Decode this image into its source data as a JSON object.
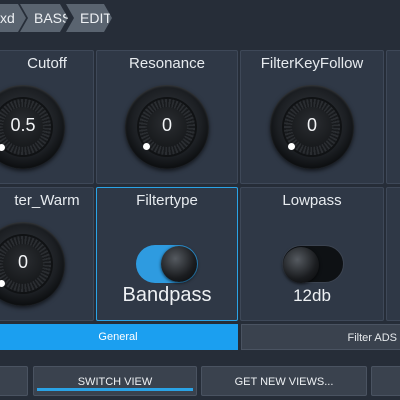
{
  "breadcrumb": [
    "xd",
    "BASS",
    "EDIT"
  ],
  "knobs_row1": [
    {
      "label": "Cutoff",
      "value": "0.5"
    },
    {
      "label": "Resonance",
      "value": "0"
    },
    {
      "label": "FilterKeyFollow",
      "value": "0"
    }
  ],
  "knobs_row2": [
    {
      "label": "ter_Warm",
      "value": "0"
    }
  ],
  "toggles": [
    {
      "label": "Filtertype",
      "value": "Bandpass",
      "state": "on"
    },
    {
      "label": "Lowpass",
      "value": "12db",
      "state": "off"
    }
  ],
  "tabs": [
    {
      "label": "General",
      "active": true
    },
    {
      "label": "Filter ADS",
      "active": false
    }
  ],
  "bottom_buttons": [
    "SWITCH VIEW",
    "GET NEW VIEWS..."
  ],
  "colors": {
    "accent": "#2aa3e6",
    "panel": "#2f3846",
    "background": "#262d38"
  }
}
